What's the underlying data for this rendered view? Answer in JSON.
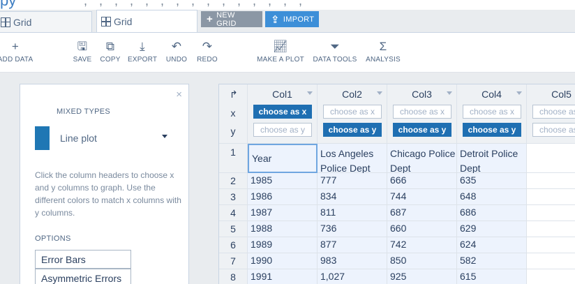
{
  "header": {
    "tabs": [
      {
        "label": "Grid"
      },
      {
        "label": "Grid"
      }
    ]
  },
  "buttons": {
    "new_grid": "NEW GRID",
    "import": "IMPORT"
  },
  "toolbar": {
    "add_data": "ADD DATA",
    "save": "SAVE",
    "copy": "COPY",
    "export": "EXPORT",
    "undo": "UNDO",
    "redo": "REDO",
    "make_plot": "MAKE A PLOT",
    "data_tools": "DATA TOOLS",
    "analysis": "ANALYSIS"
  },
  "panel": {
    "close": "×",
    "section_title": "MIXED TYPES",
    "plot_type": "Line plot",
    "plot_color": "#1f77b4",
    "help_text": "Click the column headers to choose x and y columns to graph. Use the different colors to match x columns with y columns.",
    "options_title": "OPTIONS",
    "option_buttons": [
      "Error Bars",
      "Asymmetric Errors"
    ]
  },
  "grid": {
    "x_row_label": "x",
    "y_row_label": "y",
    "choose_x": "choose as x",
    "choose_y": "choose as y",
    "columns": [
      "Col1",
      "Col2",
      "Col3",
      "Col4",
      "Col5"
    ],
    "rows": [
      {
        "num": "1",
        "cells": [
          "Year",
          "Los Angeles Police Dept",
          "Chicago Police Dept",
          "Detroit Police Dept"
        ]
      },
      {
        "num": "2",
        "cells": [
          "1985",
          "777",
          "666",
          "635"
        ]
      },
      {
        "num": "3",
        "cells": [
          "1986",
          "834",
          "744",
          "648"
        ]
      },
      {
        "num": "4",
        "cells": [
          "1987",
          "811",
          "687",
          "686"
        ]
      },
      {
        "num": "5",
        "cells": [
          "1988",
          "736",
          "660",
          "629"
        ]
      },
      {
        "num": "6",
        "cells": [
          "1989",
          "877",
          "742",
          "624"
        ]
      },
      {
        "num": "7",
        "cells": [
          "1990",
          "983",
          "850",
          "582"
        ]
      },
      {
        "num": "8",
        "cells": [
          "1991",
          "1,027",
          "925",
          "615"
        ]
      }
    ]
  }
}
